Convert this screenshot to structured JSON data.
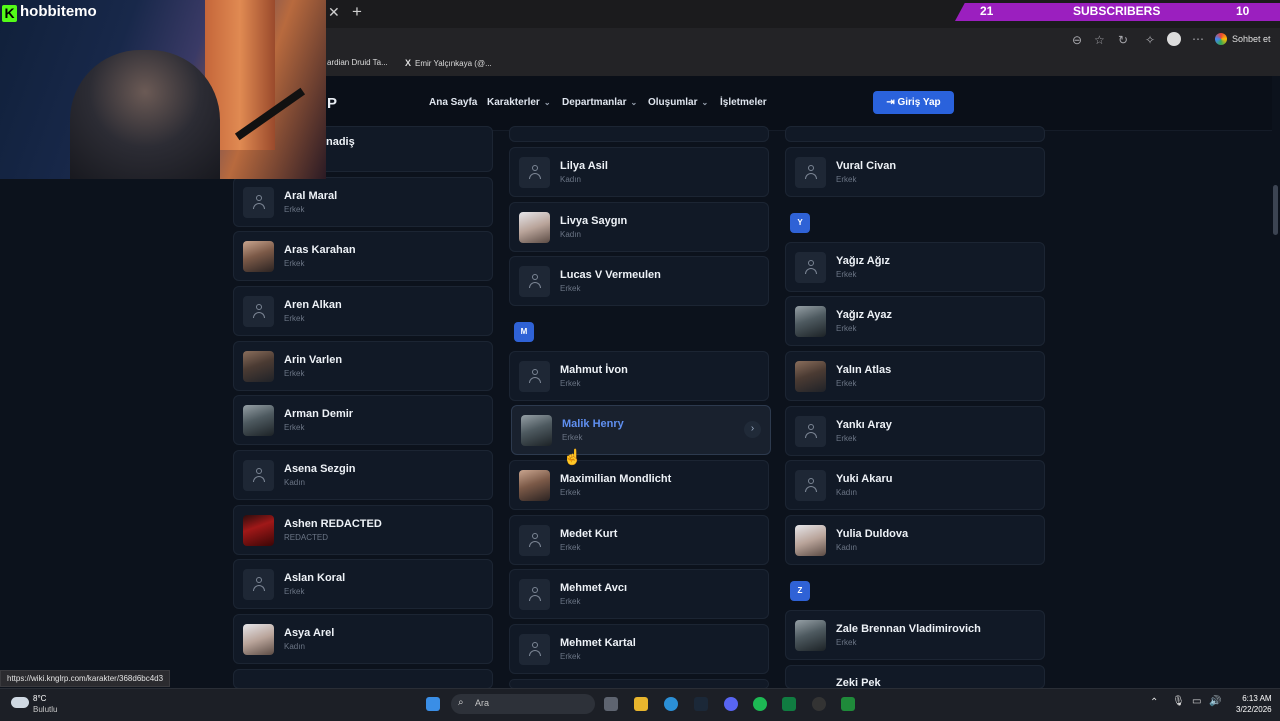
{
  "stream": {
    "channel": "hobbitemo",
    "subscribers_left": "21",
    "subscribers_label": "SUBSCRIBERS",
    "subscribers_right": "10"
  },
  "browser": {
    "chat_button": "Sohbet et",
    "bookmarks": [
      "ardian Druid Ta...",
      "Emir Yalçınkaya (@..."
    ],
    "status_url": "https://wiki.knglrp.com/karakter/368d6bc4d3"
  },
  "site": {
    "logo_fragment": "P",
    "nav": [
      {
        "label": "Ana Sayfa"
      },
      {
        "label": "Karakterler"
      },
      {
        "label": "Departmanlar"
      },
      {
        "label": "Oluşumlar"
      },
      {
        "label": "İşletmeler"
      }
    ],
    "login_label": "Giriş Yap"
  },
  "columns": {
    "left": {
      "partial_top": "nadiş",
      "items": [
        {
          "name": "Aral Maral",
          "gender": "Erkek"
        },
        {
          "name": "Aras Karahan",
          "gender": "Erkek"
        },
        {
          "name": "Aren Alkan",
          "gender": "Erkek"
        },
        {
          "name": "Arin Varlen",
          "gender": "Erkek"
        },
        {
          "name": "Arman Demir",
          "gender": "Erkek"
        },
        {
          "name": "Asena Sezgin",
          "gender": "Kadın"
        },
        {
          "name": "Ashen REDACTED",
          "gender": "REDACTED"
        },
        {
          "name": "Aslan Koral",
          "gender": "Erkek"
        },
        {
          "name": "Asya Arel",
          "gender": "Kadın"
        }
      ]
    },
    "middle": {
      "items_l": [
        {
          "name": "Lilya Asil",
          "gender": "Kadın"
        },
        {
          "name": "Livya Saygın",
          "gender": "Kadın"
        },
        {
          "name": "Lucas V Vermeulen",
          "gender": "Erkek"
        }
      ],
      "letter_m": "M",
      "items_m": [
        {
          "name": "Mahmut İvon",
          "gender": "Erkek"
        },
        {
          "name": "Malik Henry",
          "gender": "Erkek"
        },
        {
          "name": "Maximilian Mondlicht",
          "gender": "Erkek"
        },
        {
          "name": "Medet Kurt",
          "gender": "Erkek"
        },
        {
          "name": "Mehmet Avcı",
          "gender": "Erkek"
        },
        {
          "name": "Mehmet Kartal",
          "gender": "Erkek"
        }
      ]
    },
    "right": {
      "items_v": [
        {
          "name": "Vural Civan",
          "gender": "Erkek"
        }
      ],
      "letter_y": "Y",
      "items_y": [
        {
          "name": "Yağız Ağız",
          "gender": "Erkek"
        },
        {
          "name": "Yağız Ayaz",
          "gender": "Erkek"
        },
        {
          "name": "Yalın Atlas",
          "gender": "Erkek"
        },
        {
          "name": "Yankı Aray",
          "gender": "Erkek"
        },
        {
          "name": "Yuki Akaru",
          "gender": "Kadın"
        },
        {
          "name": "Yulia Duldova",
          "gender": "Kadın"
        }
      ],
      "letter_z": "Z",
      "items_z": [
        {
          "name": "Zale Brennan Vladimirovich",
          "gender": "Erkek"
        },
        {
          "name": "Zeki Pek",
          "gender": ""
        }
      ]
    }
  },
  "taskbar": {
    "weather_temp": "8°C",
    "weather_desc": "Bulutlu",
    "search_placeholder": "Ara",
    "time": "6:13 AM",
    "date": "3/22/2026"
  },
  "colors": {
    "accent": "#2a62dc",
    "page_bg": "#0c121c",
    "card_bg": "#111926",
    "stream_banner": "#9b1fbf",
    "kick_green": "#53fc18"
  }
}
